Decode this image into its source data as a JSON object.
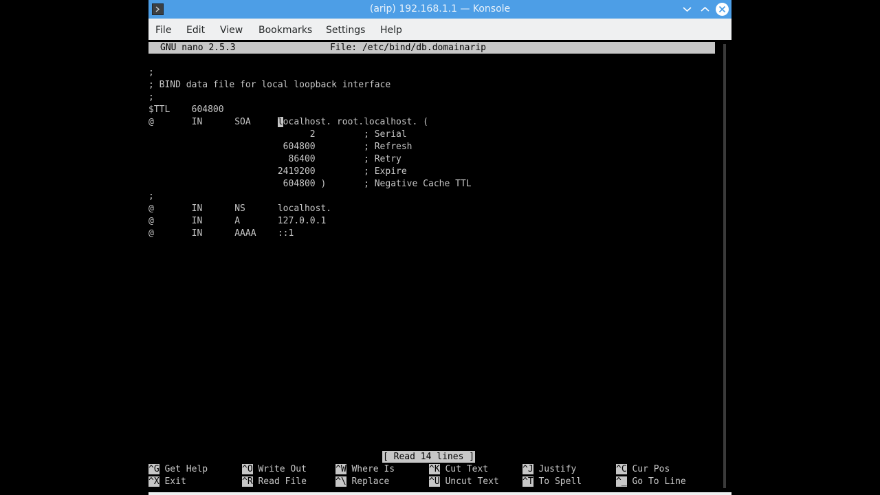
{
  "window": {
    "title": "(arip) 192.168.1.1 — Konsole"
  },
  "menubar": {
    "items": [
      "File",
      "Edit",
      "View",
      "Bookmarks",
      "Settings",
      "Help"
    ]
  },
  "nano": {
    "version": "GNU nano 2.5.3",
    "file": "File: /etc/bind/db.domainarip",
    "status": "[ Read 14 lines ]"
  },
  "file_lines": [
    ";",
    "; BIND data file for local loopback interface",
    ";",
    "$TTL    604800",
    "@       IN      SOA     localhost. root.localhost. (",
    "                              2         ; Serial",
    "                         604800         ; Refresh",
    "                          86400         ; Retry",
    "                        2419200         ; Expire",
    "                         604800 )       ; Negative Cache TTL",
    ";",
    "@       IN      NS      localhost.",
    "@       IN      A       127.0.0.1",
    "@       IN      AAAA    ::1"
  ],
  "cursor": {
    "line": 5,
    "char": "l",
    "before": "@       IN      SOA     ",
    "after": "ocalhost. root.localhost. ("
  },
  "shortcuts": [
    {
      "key": "^G",
      "label": "Get Help"
    },
    {
      "key": "^O",
      "label": "Write Out"
    },
    {
      "key": "^W",
      "label": "Where Is"
    },
    {
      "key": "^K",
      "label": "Cut Text"
    },
    {
      "key": "^J",
      "label": "Justify"
    },
    {
      "key": "^C",
      "label": "Cur Pos"
    },
    {
      "key": "^X",
      "label": "Exit"
    },
    {
      "key": "^R",
      "label": "Read File"
    },
    {
      "key": "^\\",
      "label": "Replace"
    },
    {
      "key": "^U",
      "label": "Uncut Text"
    },
    {
      "key": "^T",
      "label": "To Spell"
    },
    {
      "key": "^_",
      "label": "Go To Line"
    }
  ],
  "colors": {
    "titlebar": "#4d9ee6",
    "menubar": "#eff0f1",
    "terminal_bg": "#000000",
    "terminal_fg": "#c7c7c7"
  },
  "icons": {
    "app": "konsole-icon",
    "minimize": "chevron-down-icon",
    "maximize": "chevron-up-icon",
    "close": "close-icon"
  }
}
